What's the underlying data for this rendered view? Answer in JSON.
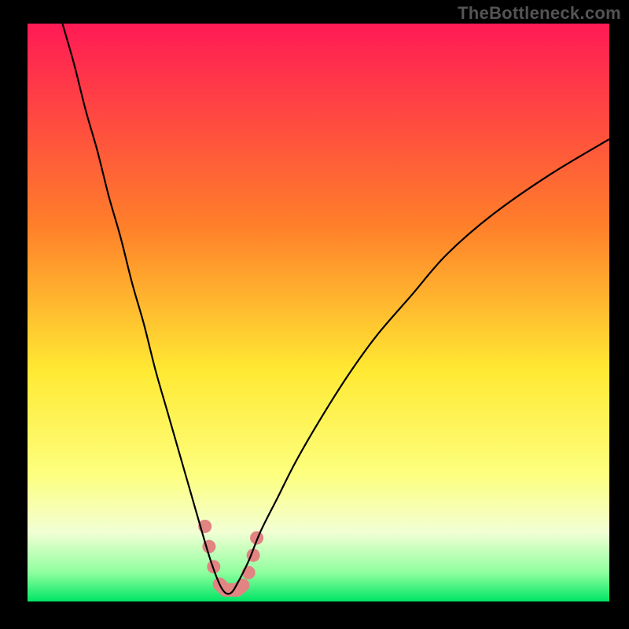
{
  "watermark": "TheBottleneck.com",
  "chart_data": {
    "type": "line",
    "title": "",
    "xlabel": "",
    "ylabel": "",
    "xlim": [
      0,
      100
    ],
    "ylim": [
      0,
      100
    ],
    "gradient_stops": [
      {
        "offset": 0,
        "color": "#ff1a55"
      },
      {
        "offset": 35,
        "color": "#ff7f2a"
      },
      {
        "offset": 60,
        "color": "#ffe933"
      },
      {
        "offset": 78,
        "color": "#fdff7e"
      },
      {
        "offset": 88,
        "color": "#f2ffd4"
      },
      {
        "offset": 95,
        "color": "#8fff9e"
      },
      {
        "offset": 100,
        "color": "#00e565"
      }
    ],
    "series": [
      {
        "name": "bottleneck-curve",
        "x": [
          6,
          8,
          10,
          12,
          14,
          16,
          18,
          20,
          22,
          24,
          26,
          28,
          30,
          31.5,
          33,
          34,
          35,
          36,
          38,
          40,
          43,
          46,
          50,
          55,
          60,
          66,
          72,
          80,
          90,
          100
        ],
        "y": [
          100,
          93,
          85,
          78,
          70,
          63,
          55,
          48,
          40,
          33,
          26,
          19,
          12,
          7,
          3,
          1.5,
          1.5,
          3,
          7,
          12,
          18,
          24,
          31,
          39,
          46,
          53,
          60,
          67,
          74,
          80
        ]
      }
    ],
    "highlight_region": {
      "name": "selected-range",
      "color": "#e18482",
      "points": [
        {
          "x": 30.5,
          "y": 13
        },
        {
          "x": 31.2,
          "y": 9.5
        },
        {
          "x": 32.0,
          "y": 6
        },
        {
          "x": 33.0,
          "y": 3
        },
        {
          "x": 34.0,
          "y": 2
        },
        {
          "x": 35.0,
          "y": 2
        },
        {
          "x": 36.0,
          "y": 2
        },
        {
          "x": 37.0,
          "y": 2.8
        },
        {
          "x": 38.0,
          "y": 5
        },
        {
          "x": 38.8,
          "y": 8
        },
        {
          "x": 39.4,
          "y": 11
        }
      ]
    }
  }
}
